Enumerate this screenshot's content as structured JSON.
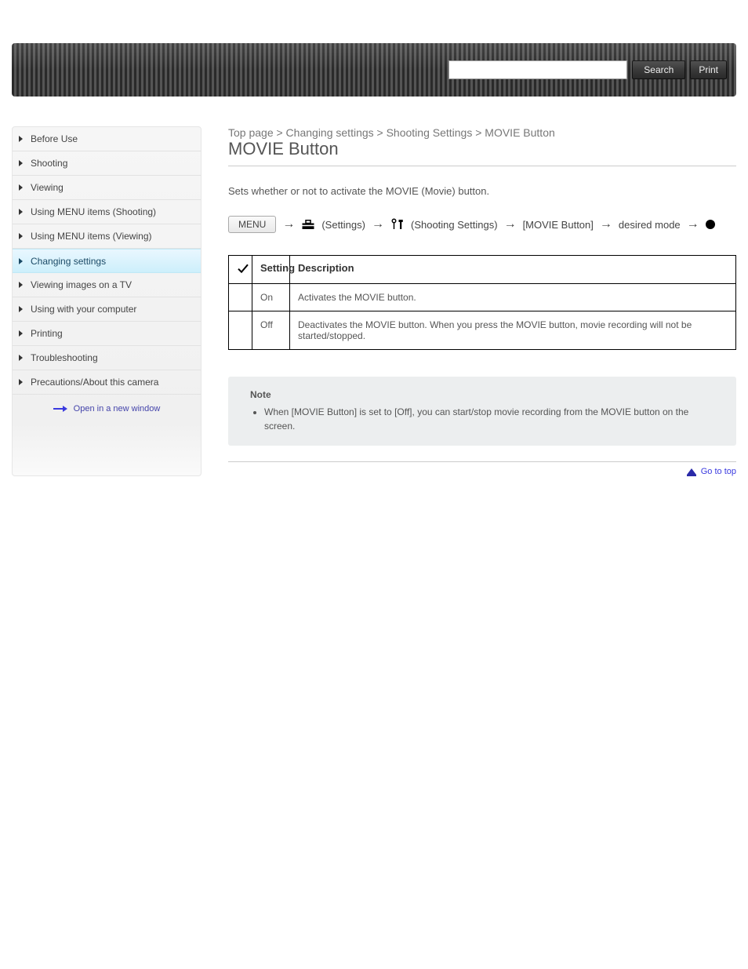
{
  "search": {
    "placeholder": "",
    "value": "",
    "search_btn": "Search",
    "print_btn": "Print"
  },
  "sidebar": {
    "items": [
      "Before Use",
      "Shooting",
      "Viewing",
      "Using MENU items (Shooting)",
      "Using MENU items (Viewing)",
      "Changing settings",
      "Viewing images on a TV",
      "Using with your computer",
      "Printing",
      "Troubleshooting",
      "Precautions/About this camera"
    ],
    "active_index": 5,
    "open_label": "Open in a new window"
  },
  "breadcrumb": "Top page > Changing settings > Shooting Settings > MOVIE Button",
  "title": "MOVIE Button",
  "lead": "Sets whether or not to activate the MOVIE (Movie) button.",
  "menu": {
    "btn": "MENU",
    "steps": [
      "(Settings)",
      "(Shooting Settings)",
      "[MOVIE Button]",
      "desired mode"
    ]
  },
  "table": {
    "headers": [
      "",
      "Setting",
      "Description"
    ],
    "rows": [
      {
        "default": true,
        "setting": "On",
        "desc": "Activates the MOVIE button."
      },
      {
        "default": false,
        "setting": "Off",
        "desc": "Deactivates the MOVIE button. When you press the MOVIE button, movie recording will not be started/stopped."
      }
    ]
  },
  "note": {
    "title": "Note",
    "items": [
      "When [MOVIE Button] is set to [Off], you can start/stop movie recording from the MOVIE button on the screen."
    ]
  },
  "footer": {
    "top": "Go to top"
  }
}
